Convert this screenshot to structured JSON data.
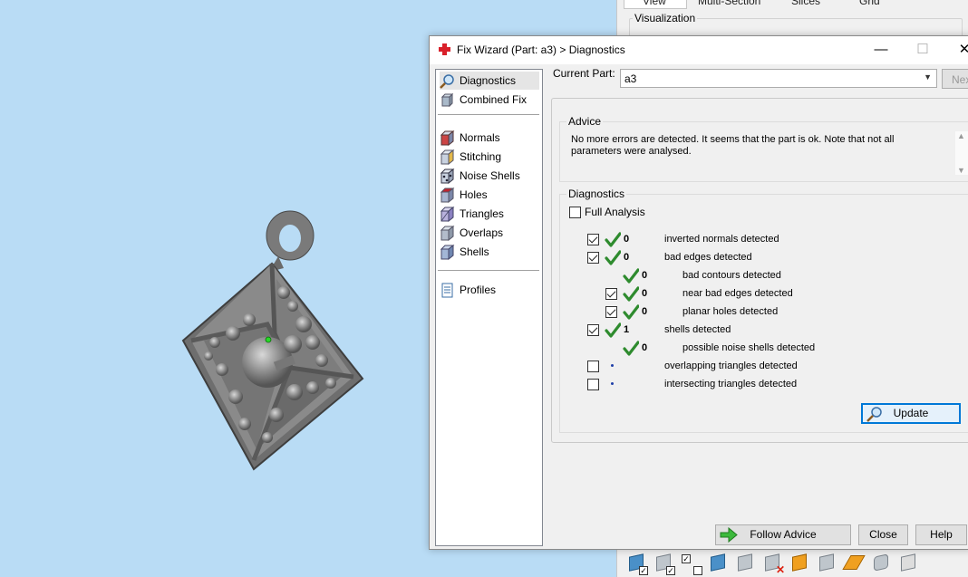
{
  "background": {
    "tabs": [
      "View",
      "Multi-Section",
      "Slices",
      "Grid"
    ],
    "visualization_label": "Visualization"
  },
  "dialog": {
    "title": "Fix Wizard (Part: a3) > Diagnostics",
    "nav": [
      {
        "label": "Diagnostics",
        "icon": "magnifier-icon"
      },
      {
        "label": "Combined Fix",
        "icon": "cube-icon"
      },
      {
        "label": "Normals",
        "icon": "normals-cube-icon"
      },
      {
        "label": "Stitching",
        "icon": "stitching-cube-icon"
      },
      {
        "label": "Noise Shells",
        "icon": "noise-shells-icon"
      },
      {
        "label": "Holes",
        "icon": "holes-cube-icon"
      },
      {
        "label": "Triangles",
        "icon": "triangles-cube-icon"
      },
      {
        "label": "Overlaps",
        "icon": "overlaps-cube-icon"
      },
      {
        "label": "Shells",
        "icon": "shells-cube-icon"
      },
      {
        "label": "Profiles",
        "icon": "profiles-document-icon"
      }
    ],
    "current_part_label": "Current Part:",
    "current_part_value": "a3",
    "next_label": "Next",
    "advice_legend": "Advice",
    "advice_text": "No more errors are detected. It seems that the part is ok. Note that not all parameters were analysed.",
    "diagnostics_legend": "Diagnostics",
    "full_analysis_label": "Full Analysis",
    "full_analysis_checked": false,
    "rows": [
      {
        "checkbox": true,
        "checked": true,
        "status": "ok",
        "count": "0",
        "label": "inverted normals detected",
        "indent": 0
      },
      {
        "checkbox": true,
        "checked": true,
        "status": "ok",
        "count": "0",
        "label": "bad edges detected",
        "indent": 0
      },
      {
        "checkbox": false,
        "checked": false,
        "status": "ok",
        "count": "0",
        "label": "bad contours detected",
        "indent": 1
      },
      {
        "checkbox": true,
        "checked": true,
        "status": "ok",
        "count": "0",
        "label": "near bad edges detected",
        "indent": 1
      },
      {
        "checkbox": true,
        "checked": true,
        "status": "ok",
        "count": "0",
        "label": "planar holes detected",
        "indent": 1
      },
      {
        "checkbox": true,
        "checked": true,
        "status": "ok",
        "count": "1",
        "label": "shells detected",
        "indent": 0
      },
      {
        "checkbox": false,
        "checked": false,
        "status": "ok",
        "count": "0",
        "label": "possible noise shells detected",
        "indent": 1
      },
      {
        "checkbox": true,
        "checked": false,
        "status": "not-analysed",
        "count": "",
        "label": "overlapping triangles detected",
        "indent": 0
      },
      {
        "checkbox": true,
        "checked": false,
        "status": "not-analysed",
        "count": "",
        "label": "intersecting triangles detected",
        "indent": 0
      }
    ],
    "update_label": "Update",
    "follow_advice_label": "Follow Advice",
    "close_label": "Close",
    "help_label": "Help"
  },
  "colors": {
    "viewport": "#b9dcf5",
    "check_green": "#2e8b2e",
    "dot_blue": "#1f3fa8",
    "accent": "#0078d7"
  }
}
